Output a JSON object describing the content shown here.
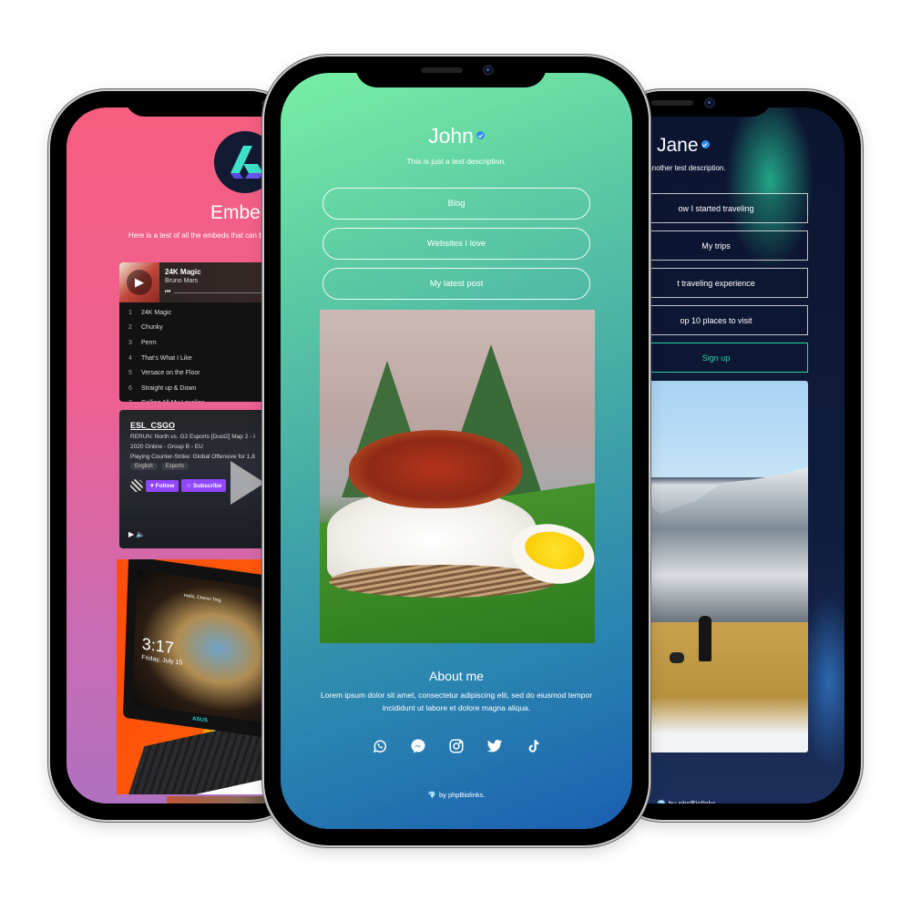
{
  "colors": {
    "left_bg_top": "#f65e7f",
    "left_bg_bottom": "#b070c0",
    "center_bg_top": "#78f0a4",
    "center_bg_bottom": "#1a5fb0",
    "right_bg": "#0f1c3c",
    "verified_badge": "#2f8ff0",
    "twitch_purple": "#9147ff",
    "signup_accent": "#2fd3a6"
  },
  "left_phone": {
    "logo_icon": "brand-logo-icon",
    "title": "Embeds",
    "description": "Here is a test of all the embeds that can be ad",
    "spotify": {
      "track": "24K Magic",
      "artist": "Bruno Mars",
      "play_icon": "▶",
      "prev_icon": "⏮",
      "tracks": [
        {
          "num": "1",
          "title": "24K Magic"
        },
        {
          "num": "2",
          "title": "Chunky"
        },
        {
          "num": "3",
          "title": "Perm"
        },
        {
          "num": "4",
          "title": "That's What I Like"
        },
        {
          "num": "5",
          "title": "Versace on the Floor"
        },
        {
          "num": "6",
          "title": "Straight up & Down"
        },
        {
          "num": "7",
          "title": "Calling All My Lovelies"
        }
      ]
    },
    "twitch": {
      "channel": "ESL_CSGO",
      "title_line1": "RERUN: North vs. G2 Esports [Dust2] Map 2 - I",
      "title_line2": "2020 Online - Group B - EU",
      "game_line": "Playing Counter-Strike: Global Offensive for 1,8",
      "tags": [
        "English",
        "Esports"
      ],
      "follow_label": "♥ Follow",
      "subscribe_label": "☆ Subscribe",
      "controls": "▶ 🔈"
    },
    "ad": {
      "time": "3:17",
      "date": "Friday, July 15",
      "greeting": "Hello, Chenxi Ting",
      "brand": "ASUS"
    }
  },
  "center_phone": {
    "name": "John",
    "description": "This is just a test description.",
    "links": [
      "Blog",
      "Websites I love",
      "My latest post"
    ],
    "about_title": "About me",
    "about_text": "Lorem ipsum dolor sit amet, consectetur adipiscing elit, sed do eiusmod tempor incididunt ut labore et dolore magna aliqua.",
    "socials": [
      "whatsapp",
      "messenger",
      "instagram",
      "twitter",
      "tiktok"
    ],
    "footer_gem": "💎",
    "footer_text": "by phpBiolinks."
  },
  "right_phone": {
    "name": "Jane",
    "description": "s another test description.",
    "links": [
      "ow I started traveling",
      "My trips",
      "t traveling experience",
      "op 10 places to visit"
    ],
    "signup_label": "Sign up",
    "footer_gem": "💎",
    "footer_text": "by phpBiolinks."
  }
}
